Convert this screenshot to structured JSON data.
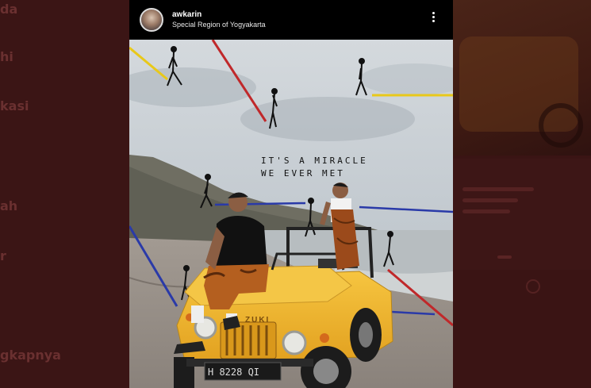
{
  "background": {
    "words": [
      "da",
      "hi",
      "kasi",
      "ah",
      "r",
      "gkapnya"
    ]
  },
  "post": {
    "username": "awkarin",
    "location": "Special Region of Yogyakarta",
    "image_text_line1": "IT'S A MIRACLE",
    "image_text_line2": "WE EVER MET",
    "jeep_badge": "ZUKI",
    "license_plate": "H 8228 QI",
    "more_icon": "more-vertical-icon"
  },
  "colors": {
    "jeep_yellow": "#f2b42a",
    "doodle_red": "#c0282a",
    "doodle_blue": "#2a3aa8",
    "doodle_yellow": "#e8c81a"
  }
}
